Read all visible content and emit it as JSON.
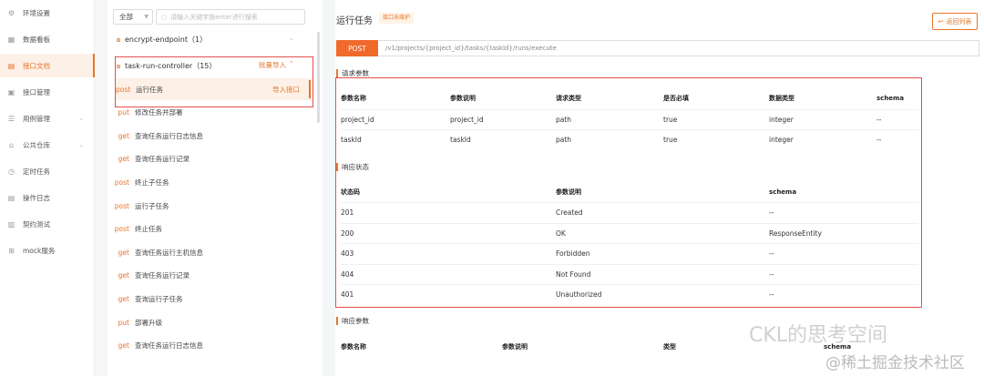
{
  "nav": {
    "items": [
      {
        "label": "环境设置",
        "icon": "gear-icon",
        "glyph": "⚙",
        "active": false,
        "chevron": false
      },
      {
        "label": "数据看板",
        "icon": "dashboard-icon",
        "glyph": "▦",
        "active": false,
        "chevron": false
      },
      {
        "label": "接口文档",
        "icon": "document-icon",
        "glyph": "▤",
        "active": true,
        "chevron": false
      },
      {
        "label": "接口管理",
        "icon": "api-manage-icon",
        "glyph": "▣",
        "active": false,
        "chevron": false
      },
      {
        "label": "用例管理",
        "icon": "case-icon",
        "glyph": "☰",
        "active": false,
        "chevron": true
      },
      {
        "label": "公共仓库",
        "icon": "repository-icon",
        "glyph": "⌂",
        "active": false,
        "chevron": true
      },
      {
        "label": "定时任务",
        "icon": "clock-icon",
        "glyph": "◷",
        "active": false,
        "chevron": false
      },
      {
        "label": "操作日志",
        "icon": "log-icon",
        "glyph": "▤",
        "active": false,
        "chevron": false
      },
      {
        "label": "契约测试",
        "icon": "contract-icon",
        "glyph": "▥",
        "active": false,
        "chevron": false
      },
      {
        "label": "mock服务",
        "icon": "mock-icon",
        "glyph": "⊞",
        "active": false,
        "chevron": false
      }
    ]
  },
  "tree": {
    "filter_value": "全部",
    "search_placeholder": "请输入关键字按enter进行搜索",
    "groups": [
      {
        "name": "encrypt-endpoint（1）"
      },
      {
        "name": "task-run-controller（15）",
        "action": "批量导入"
      }
    ],
    "selected_import_label": "导入接口",
    "apis": [
      {
        "method": "post",
        "name": "运行任务"
      },
      {
        "method": "put",
        "name": "修改任务并部署"
      },
      {
        "method": "get",
        "name": "查询任务运行日志信息"
      },
      {
        "method": "get",
        "name": "查询任务运行记录"
      },
      {
        "method": "post",
        "name": "终止子任务"
      },
      {
        "method": "post",
        "name": "运行子任务"
      },
      {
        "method": "post",
        "name": "终止任务"
      },
      {
        "method": "get",
        "name": "查询任务运行主机信息"
      },
      {
        "method": "get",
        "name": "查询任务运行记录"
      },
      {
        "method": "get",
        "name": "查询运行子任务"
      },
      {
        "method": "put",
        "name": "部署升级"
      },
      {
        "method": "get",
        "name": "查询任务运行日志信息"
      }
    ]
  },
  "main": {
    "title": "运行任务",
    "tag": "接口未维护",
    "back_label": "返回列表",
    "method": "POST",
    "url": "/v1/projects/{project_id}/tasks/{taskId}/runs/execute",
    "request_section": "请求参数",
    "request_headers": [
      "参数名称",
      "参数说明",
      "请求类型",
      "是否必填",
      "数据类型",
      "schema"
    ],
    "request_rows": [
      [
        "project_id",
        "project_id",
        "path",
        "true",
        "integer",
        "--"
      ],
      [
        "taskId",
        "taskId",
        "path",
        "true",
        "integer",
        "--"
      ]
    ],
    "response_status_section": "响应状态",
    "status_headers": [
      "状态码",
      "参数说明",
      "schema"
    ],
    "status_rows": [
      [
        "201",
        "Created",
        "--"
      ],
      [
        "200",
        "OK",
        "ResponseEntity"
      ],
      [
        "403",
        "Forbidden",
        "--"
      ],
      [
        "404",
        "Not Found",
        "--"
      ],
      [
        "401",
        "Unauthorized",
        "--"
      ]
    ],
    "response_params_section": "响应参数",
    "response_headers": [
      "参数名称",
      "参数说明",
      "类型",
      "schema"
    ]
  },
  "watermark": {
    "line1": "CKL的思考空间",
    "line2": "@稀土掘金技术社区"
  }
}
